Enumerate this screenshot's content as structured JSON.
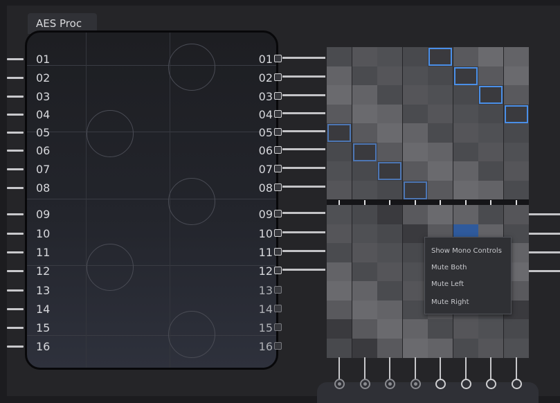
{
  "panel": {
    "title": "AES Proc"
  },
  "inputs": [
    "01",
    "02",
    "03",
    "04",
    "05",
    "06",
    "07",
    "08",
    "09",
    "10",
    "11",
    "12",
    "13",
    "14",
    "15",
    "16"
  ],
  "outputs": [
    "01",
    "02",
    "03",
    "04",
    "05",
    "06",
    "07",
    "08",
    "09",
    "10",
    "11",
    "12",
    "13",
    "14",
    "15",
    "16"
  ],
  "context_menu": {
    "items": [
      "Show Mono Controls",
      "Mute Both",
      "Mute Left",
      "Mute Right"
    ]
  },
  "colors": {
    "accent": "#4a8fe8",
    "background": "#252528"
  }
}
